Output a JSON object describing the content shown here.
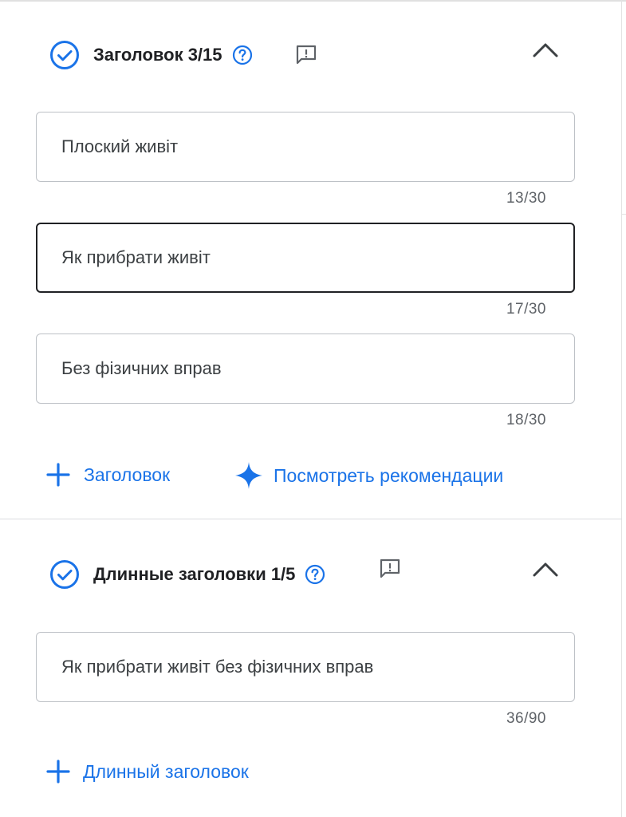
{
  "headlines": {
    "title": "Заголовок 3/15",
    "fields": [
      {
        "value": "Плоский живіт",
        "counter": "13/30"
      },
      {
        "value": "Як прибрати живіт",
        "counter": "17/30"
      },
      {
        "value": "Без фізичних вправ",
        "counter": "18/30"
      }
    ],
    "add_label": "Заголовок",
    "recommend_label": "Посмотреть рекомендации"
  },
  "long_headlines": {
    "title": "Длинные заголовки 1/5",
    "fields": [
      {
        "value": "Як прибрати живіт без фізичних вправ",
        "counter": "36/90"
      }
    ],
    "add_label": "Длинный заголовок"
  },
  "colors": {
    "accent": "#1a73e8",
    "text": "#202124",
    "border": "#bdc1c6",
    "counter": "#5f6368"
  },
  "icons": [
    "check-circle-icon",
    "help-icon",
    "feedback-icon",
    "chevron-up-icon",
    "plus-icon",
    "sparkle-icon"
  ]
}
